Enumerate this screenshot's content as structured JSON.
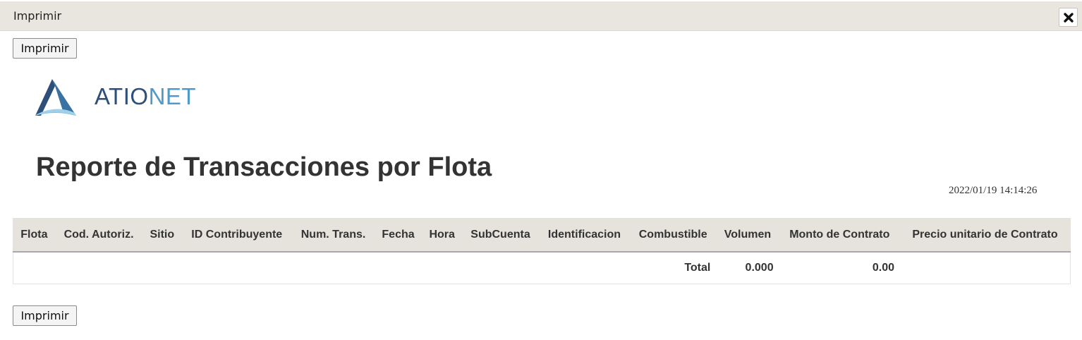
{
  "window": {
    "title": "Imprimir",
    "close_icon": "close-icon"
  },
  "buttons": {
    "print_top_label": "Imprimir",
    "print_bottom_label": "Imprimir"
  },
  "logo": {
    "text_part1": "ATIO",
    "text_part2": "NET",
    "colors": {
      "dark": "#2e4f7a",
      "light": "#4d9bc9"
    }
  },
  "report": {
    "title": "Reporte de Transacciones por Flota",
    "datetime": "2022/01/19 14:14:26"
  },
  "table": {
    "headers": [
      "Flota",
      "Cod. Autoriz.",
      "Sitio",
      "ID Contribuyente",
      "Num. Trans.",
      "Fecha",
      "Hora",
      "SubCuenta",
      "Identificacion",
      "Combustible",
      "Volumen",
      "Monto de Contrato",
      "Precio unitario de Contrato"
    ],
    "total_row": {
      "label": "Total",
      "volumen": "0.000",
      "monto": "0.00"
    }
  },
  "colors": {
    "titlebar_bg": "#e8e6df",
    "header_bg": "#e5e3dc",
    "text": "#333333"
  }
}
